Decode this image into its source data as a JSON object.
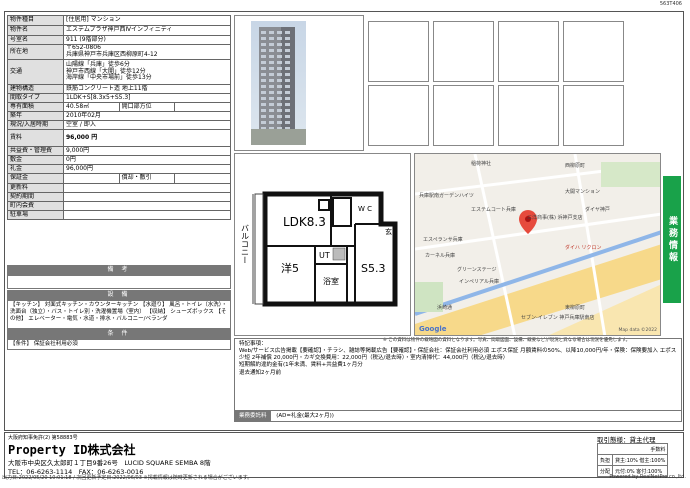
{
  "code": "563T406",
  "rows": [
    {
      "k": "物件種目",
      "v": "[住居用] マンション"
    },
    {
      "k": "物件名",
      "v": "エステムプラザ神戸西Ⅳインフィニティ"
    },
    {
      "k": "号室名",
      "v": "911 (9階部分)"
    },
    {
      "k": "所在地",
      "v": "〒652-0806\n兵庫県神戸市兵庫区西柳原町4-12"
    },
    {
      "k": "交通",
      "v": "山陽線「兵庫」徒歩6分\n神戸市西線「大開」徒歩12分\n海岸線「中央市場前」徒歩13分"
    },
    {
      "k": "建物構造",
      "v": "鉄筋コンクリート造 地上11階"
    },
    {
      "k": "間取タイプ",
      "v": "1LDK+S[8.3x5+S5.3]"
    },
    {
      "k": "専有面積",
      "v": "40.58㎡",
      "k2": "開口部方位",
      "v2": ""
    },
    {
      "k": "築年",
      "v": "2010年02月"
    },
    {
      "k": "現況/入居時期",
      "v": "空室 / 即入"
    },
    {
      "k": "賃料",
      "v": "96,000 円"
    },
    {
      "k": "共益費・管理費",
      "v": "9,000円"
    },
    {
      "k": "敷金",
      "v": "0円"
    },
    {
      "k": "礼金",
      "v": "96,000円"
    },
    {
      "k": "保証金",
      "v": "",
      "k2": "償却・敷引",
      "v2": ""
    },
    {
      "k": "更新料",
      "v": ""
    },
    {
      "k": "契約期間",
      "v": ""
    },
    {
      "k": "町内会費",
      "v": ""
    },
    {
      "k": "駐車場",
      "v": ""
    }
  ],
  "biko_label": "備 考",
  "setsubi_label": "設 備",
  "setsubi_text": "【キッチン】 対面式キッチン・カウンターキッチン 【水廻り】 風呂・トイレ（水洗）・洗面台（独立）・バス・トイレ別・洗濯機置場（室内） 【収納】 シューズボックス 【その他】 エレベーター・電気・水道・排水・バルコニー/ベランダ",
  "joken_label": "条 件",
  "joken_text": "【条件】 保証会社利用必須",
  "plan": {
    "ldk": "LDK8.3",
    "wc": "W C",
    "you": "洋5",
    "ut": "UT",
    "yoku": "浴室",
    "s": "S5.3",
    "balcony": "バルコニー",
    "gen": "玄"
  },
  "map": {
    "places": [
      "稲荷神社",
      "西柳原町",
      "兵庫駅南ガーデンハイツ",
      "エステムコート兵庫",
      "大開マンション",
      "エスペランサ兵庫",
      "三洋商事(株) 浜神戸支店",
      "ダイヤ神戸",
      "カーネル兵庫",
      "グリーンステージ",
      "ダイハ リクロン",
      "インペリアル兵庫",
      "浜崎通",
      "東柳原町",
      "セブン-イレブン 神戸兵庫駅南店"
    ],
    "google": "Google",
    "credit": "Map data ©2022"
  },
  "map_note": "※ この資料は物件の概略図の資料となります。写真、間取図面、設備、概要などが現況と異なる場合は現況を優先します。",
  "side_tab": "業務情報",
  "remark_label": "特記事項：",
  "remark_text": "Web/サービス広告掲載【要確認】・チラシ、雑誌等掲載広告【要確認】・保証会社：保証会社利用必須 エポス保証 月額賃料の50%、以降10,000円/年・保険：保険要加入 エポス少短 2年補償 20,000円・カギ交換費用：22,000円（税込/退去時）・室内清掃代：44,000円（税込/退去時）\n短期解約違約金有(1年未満、賃料+共益費1ヶ月分\n退去通知2ヶ月前",
  "agent_label": "業務委託料",
  "agent_val": "(AD=礼金(最大2ヶ月))",
  "company": {
    "license": "大阪府知事免許(2) 第58883号",
    "name": "Property ID株式会社",
    "addr": "大阪市中央区久太郎町１丁目9番26号　LUCID SQUARE SEMBA 8階",
    "tel": "TEL：06-6263-1114　FAX：06-6263-0016"
  },
  "deal": {
    "title": "取引態様：貸主代理",
    "fee_label": "手数料",
    "r1a": "負担",
    "r1b": "貸主:10% 借主:100%",
    "r2a": "分配",
    "r2b": "元付:0% 客付:100%"
  },
  "bottom_left": "出力日:2022/05/20 10:01:18 / 次回更新予定日:2022/06/03 ※掲載情報は随時更新される場合がございます。",
  "bottom_right": "Powered by RealNetPro co.,ltd."
}
